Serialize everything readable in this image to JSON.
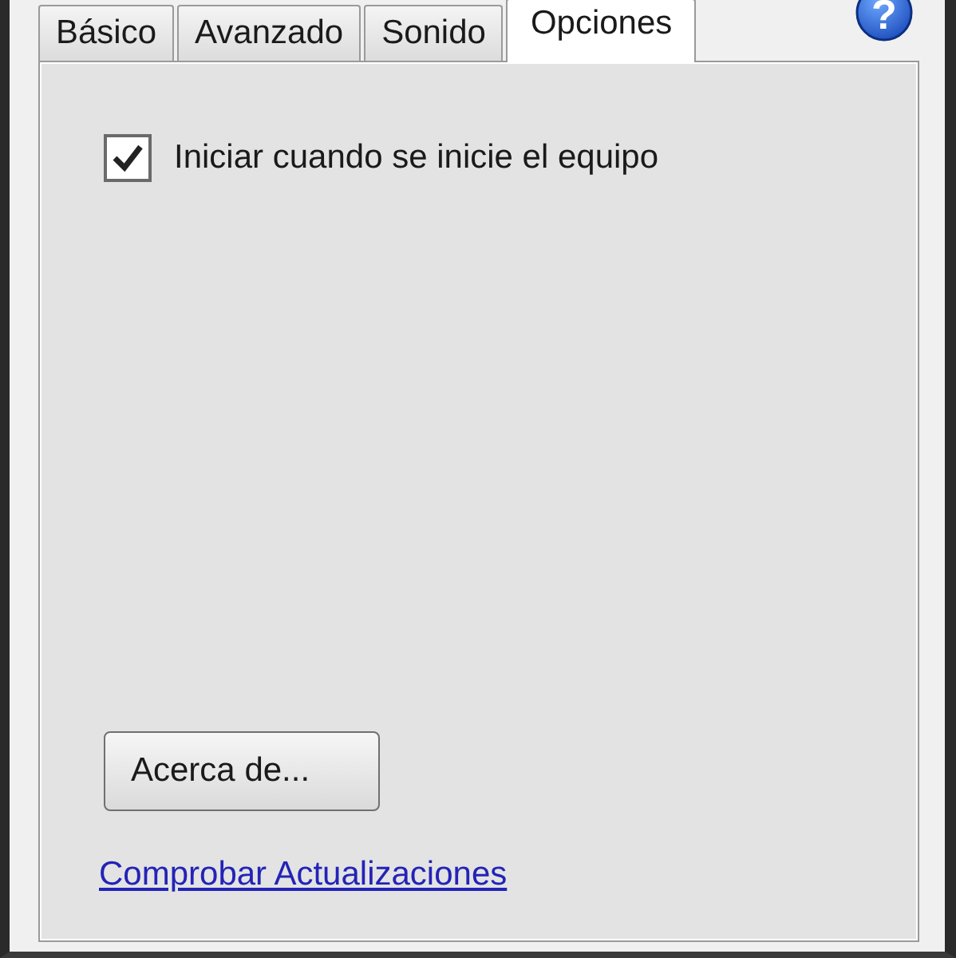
{
  "tabs": [
    {
      "label": "Básico",
      "selected": false
    },
    {
      "label": "Avanzado",
      "selected": false
    },
    {
      "label": "Sonido",
      "selected": false
    },
    {
      "label": "Opciones",
      "selected": true
    }
  ],
  "help_button": {
    "label": "?"
  },
  "options": [
    {
      "label": "Iniciar cuando se inicie el equipo",
      "checked": true
    }
  ],
  "about_button": "Acerca de...",
  "update_link": "Comprobar Actualizaciones"
}
